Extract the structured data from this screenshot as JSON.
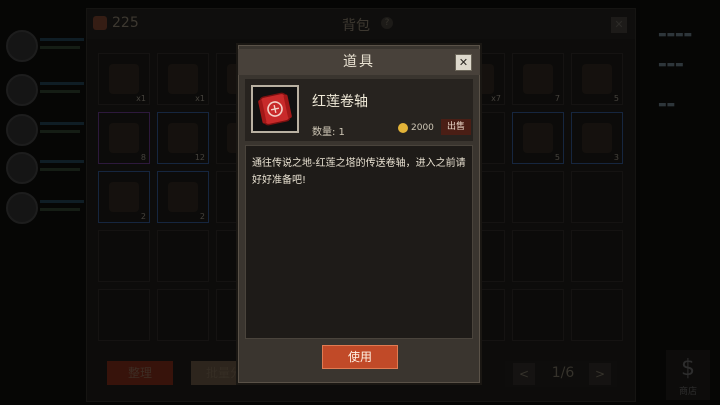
{
  "bag": {
    "coin_count": "225",
    "title": "背包",
    "help_symbol": "?",
    "close_symbol": "✕",
    "sort_label": "整理",
    "batch_label": "批量分",
    "page_indicator": "1/6",
    "prev_symbol": "<",
    "next_symbol": ">"
  },
  "slots": [
    {
      "rarity": "normal",
      "count": "x1",
      "icon": "red-scroll-icon"
    },
    {
      "rarity": "normal",
      "count": "x1",
      "icon": "red-scroll-icon"
    },
    {
      "rarity": "normal",
      "count": "",
      "icon": "scroll-icon"
    },
    {
      "rarity": "normal",
      "count": "x7",
      "icon": "item-icon"
    },
    {
      "rarity": "normal",
      "count": "7",
      "icon": "boots-icon"
    },
    {
      "rarity": "normal",
      "count": "5",
      "icon": "bow-icon"
    },
    {
      "rarity": "purple",
      "count": "8",
      "icon": "armor-icon"
    },
    {
      "rarity": "blue",
      "count": "12",
      "icon": "bow-icon"
    },
    {
      "rarity": "normal",
      "count": "",
      "icon": "sword-icon"
    },
    {
      "rarity": "blue",
      "count": "5",
      "icon": "gloves-icon"
    },
    {
      "rarity": "blue",
      "count": "3",
      "icon": "gloves-icon"
    },
    {
      "rarity": "blue",
      "count": "2",
      "icon": "blade-icon"
    },
    {
      "rarity": "blue",
      "count": "2",
      "icon": "gloves-icon"
    }
  ],
  "dialog": {
    "title": "道具",
    "close_symbol": "✕",
    "item_name": "红莲卷轴",
    "quantity_label": "数量: 1",
    "price": "2000",
    "sell_label": "出售",
    "description": "通往传说之地-红莲之塔的传送卷轴，进入之前请好好准备吧!",
    "use_label": "使用"
  },
  "shop": {
    "symbol": "$",
    "label": "商店"
  },
  "colors": {
    "accent_red": "#c14a28",
    "coin_gold": "#e2b338",
    "rare_blue": "#2d4c7e",
    "epic_purple": "#5a3278"
  }
}
